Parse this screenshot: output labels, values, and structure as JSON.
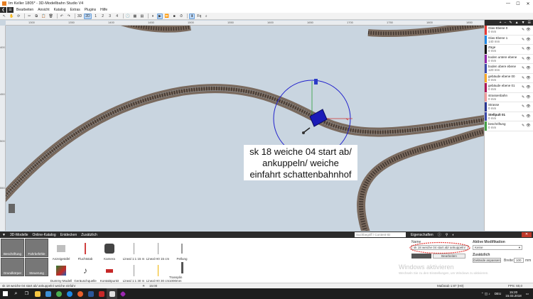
{
  "window": {
    "title": "Im Keller 1805* - 3D-Modellbahn Studio V4",
    "controls": [
      "—",
      "☐",
      "✕"
    ]
  },
  "menu": [
    "Bearbeiten",
    "Ansicht",
    "Katalog",
    "Extras",
    "Plugins",
    "Hilfe"
  ],
  "toolbar": {
    "view3d": "3D",
    "view2d": "2D",
    "pages": [
      "1",
      "2",
      "3",
      "4"
    ],
    "zoom_label": "Fq"
  },
  "ruler": {
    "top_ticks": [
      "1300",
      "1350",
      "1400",
      "1450",
      "1500",
      "1550",
      "1600",
      "1650",
      "1700",
      "1750",
      "1800",
      "1850"
    ],
    "left_ticks": [
      "400",
      "450",
      "500",
      "550"
    ]
  },
  "layers": [
    {
      "name": "Glas Ebene 0",
      "height": "0 mm",
      "color": "#e53935"
    },
    {
      "name": "Glas Ebene 1",
      "height": "140 mm",
      "color": "#1e88e5"
    },
    {
      "name": "Züge",
      "height": "0 mm",
      "color": "#111111"
    },
    {
      "name": "boden untere ebene",
      "height": "0 mm",
      "color": "#8e24aa"
    },
    {
      "name": "boden obere ebene",
      "height": "120 mm",
      "color": "#3949ab"
    },
    {
      "name": "gebäude ebene 00",
      "height": "0 mm",
      "color": "#f9a825"
    },
    {
      "name": "gebäude ebene 01",
      "height": "0 mm",
      "color": "#ad1457"
    },
    {
      "name": "strassenbahn",
      "height": "0 mm",
      "color": "#ef9a9a"
    },
    {
      "name": "Strasse",
      "height": "0 mm",
      "color": "#283593"
    },
    {
      "name": "Stellpult 01",
      "height": "0 mm",
      "color": "#3949ab",
      "active": true
    },
    {
      "name": "beschriftung",
      "height": "0 mm",
      "color": "#43a047"
    }
  ],
  "caption": {
    "line1": "sk 18 weiche 04 start ab/",
    "line2": "ankuppeln/ weiche",
    "line3": "einfahrt schattenbahnhof"
  },
  "catalog": {
    "breadcrumb": [
      "3D-Modelle",
      "Online-Katalog",
      "Entdecken",
      "Zusätzlich"
    ],
    "search_placeholder": "Suchbegriff / Content-ID",
    "sidecats": [
      "Beschriftung",
      "Fahrbefehle",
      "Grundkörper",
      "Steuerung"
    ],
    "items": [
      "Anzeigetafel",
      "Fluchtstab",
      "Kamera",
      "Lineal 1:1 15 m",
      "Lineal H0 15 cm",
      "Pellung",
      "Dummy-Modell",
      "Geräuschquelle",
      "Kontaktpunkt",
      "Lineal 1:1 30 m",
      "Lineal H0 30 cm",
      "Transplin 1000mm"
    ]
  },
  "properties": {
    "tab": "Eigenschaften",
    "name_label": "Name",
    "name_value": "sk 18 weiche 04 start ab/ ankuppeln/",
    "color_btn": "Bearbeiten",
    "active_mod_label": "Aktive Modifikation",
    "active_mod_value": "Keine",
    "extra_label": "Zusätzlich",
    "fit_terrain": "Gelände anpassen",
    "width_label": "Breite:",
    "width_value": "100",
    "width_unit": "mm",
    "watermark1": "Windows aktivieren",
    "watermark2": "Wechseln Sie zu den Einstellungen, um Windows zu aktivieren."
  },
  "status": {
    "left": "sk 18 weiche 04 start ab/ ankuppeln/ weiche einfahr",
    "time": "15:00",
    "scale": "Maßstab 1:87 (H0)",
    "fps": "FPS: 60,0"
  },
  "taskbar": {
    "time": "15:20",
    "date": "15.03.2018",
    "lang": "DEU"
  }
}
